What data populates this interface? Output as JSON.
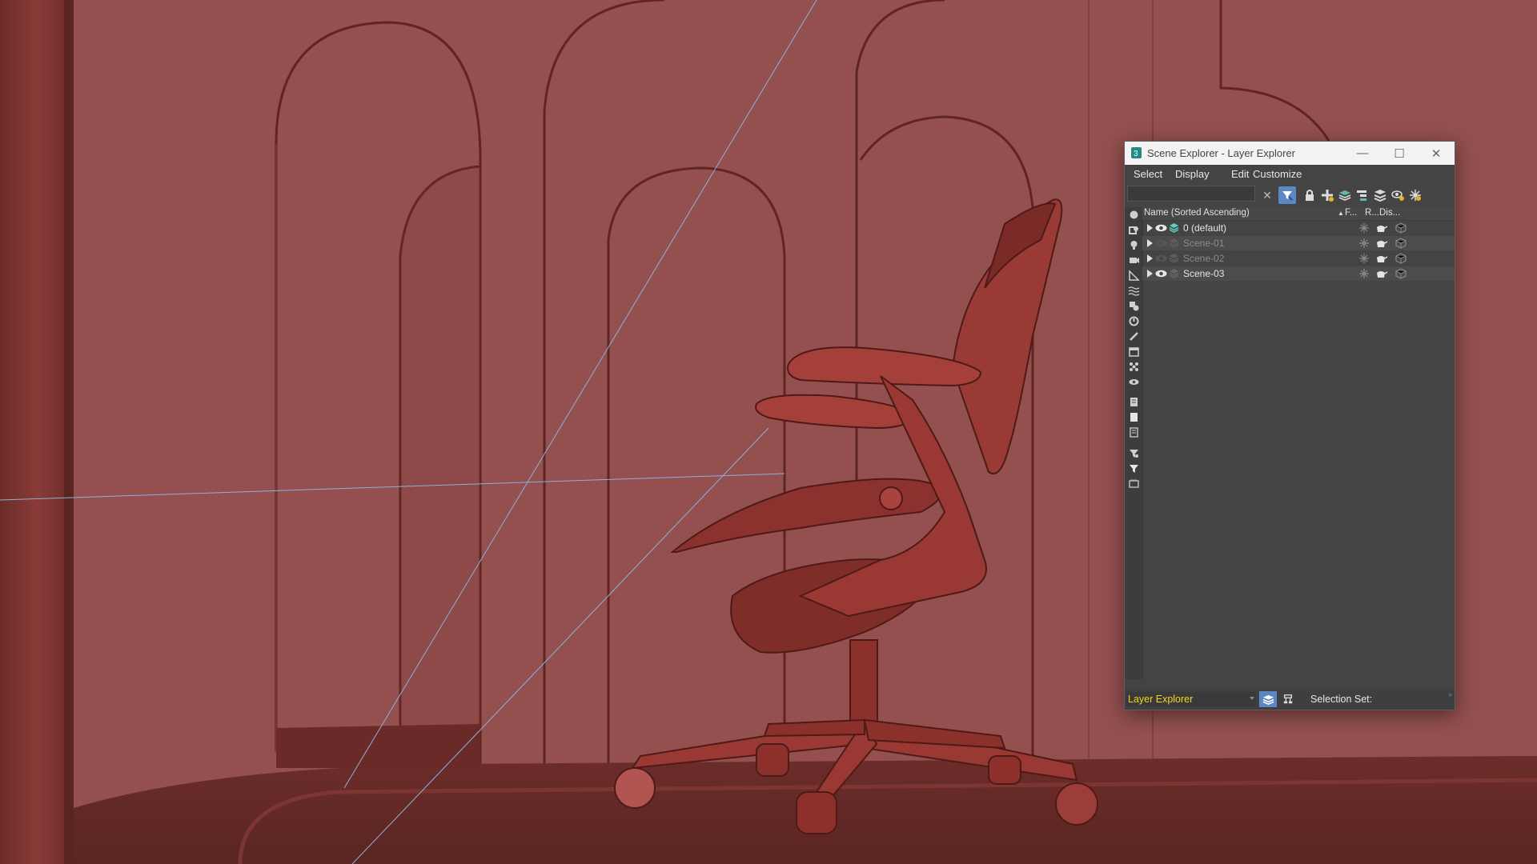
{
  "window": {
    "title": "Scene Explorer - Layer Explorer",
    "minimize_glyph": "—",
    "maximize_glyph": "☐",
    "close_glyph": "✕"
  },
  "menu": {
    "items": [
      "Select",
      "Display",
      "Edit",
      "Customize"
    ]
  },
  "search": {
    "value": "",
    "placeholder": "",
    "clear_glyph": "✕"
  },
  "toolbar": {
    "buttons": [
      "filter-icon",
      "lock-icon",
      "new-layer-icon",
      "add-to-layer-icon",
      "hierarchy-icon",
      "layers-icon",
      "eye-settings-icon",
      "settings-icon"
    ]
  },
  "list": {
    "headers": {
      "name": "Name (Sorted Ascending)",
      "sort_glyph": "▲",
      "freeze": "F...",
      "render": "R...",
      "display": "Dis..."
    },
    "rows": [
      {
        "name": "0 (default)",
        "visible": true,
        "active": true
      },
      {
        "name": "Scene-01",
        "visible": false,
        "active": false
      },
      {
        "name": "Scene-02",
        "visible": false,
        "active": false
      },
      {
        "name": "Scene-03",
        "visible": true,
        "active": false
      }
    ]
  },
  "status": {
    "mode": "Layer Explorer",
    "selection_set_label": "Selection Set:",
    "resize_glyph": "»"
  },
  "colors": {
    "viewport_bg": "#93504f",
    "panel_bg": "#444444",
    "accent": "#5b88c3",
    "mode_text": "#f2d51d"
  }
}
